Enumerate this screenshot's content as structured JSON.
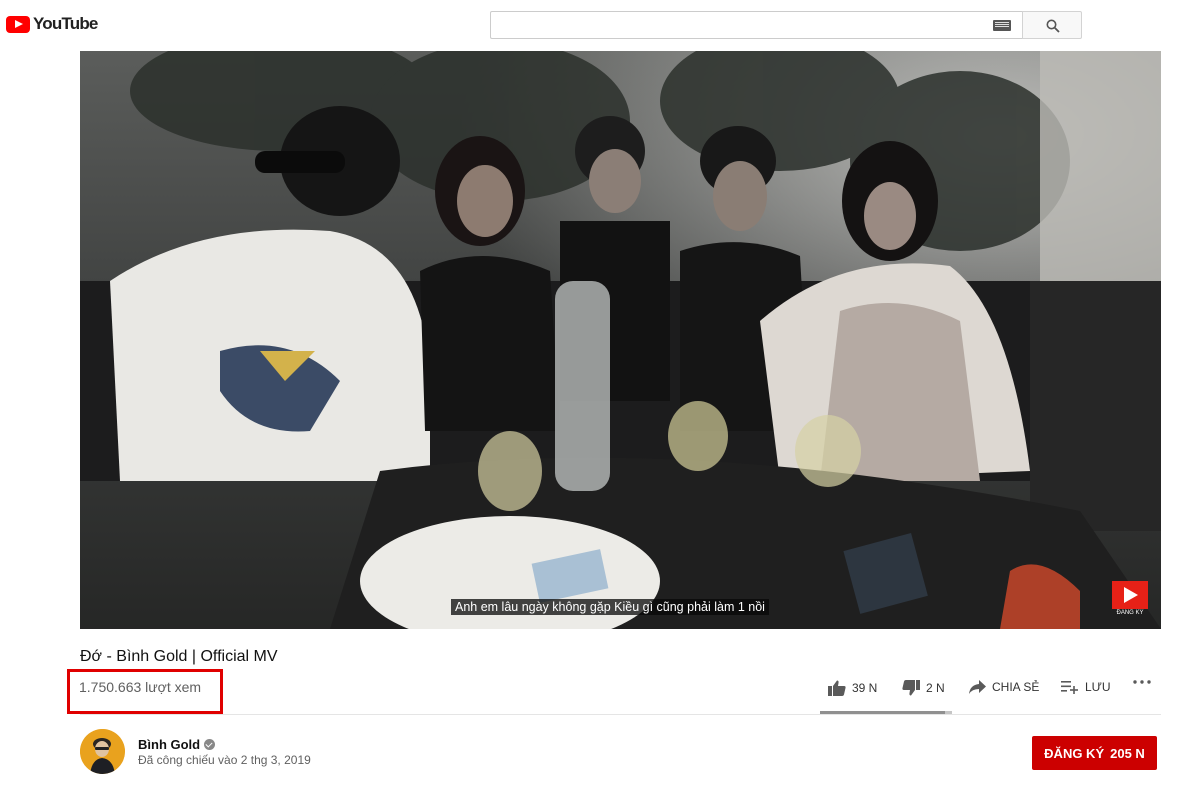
{
  "header": {
    "logo_text": "YouTube",
    "search_placeholder": ""
  },
  "player": {
    "subtitle": "Anh em lâu ngày không gặp Kiều gì cũng phải làm 1 nồi",
    "watermark_label": "ĐĂNG KÝ"
  },
  "video": {
    "title": "Đớ - Bình Gold | Official MV",
    "views": "1.750.663 lượt xem"
  },
  "actions": {
    "like_count": "39 N",
    "dislike_count": "2 N",
    "share_label": "CHIA SẺ",
    "save_label": "LƯU",
    "like_ratio": 0.95
  },
  "channel": {
    "name": "Bình Gold",
    "published": "Đã công chiếu vào 2 thg 3, 2019"
  },
  "subscribe": {
    "label": "ĐĂNG KÝ",
    "count": "205 N"
  },
  "colors": {
    "brand_red": "#ff0000",
    "subscribe_red": "#cc0000",
    "highlight_red": "#e00000"
  }
}
